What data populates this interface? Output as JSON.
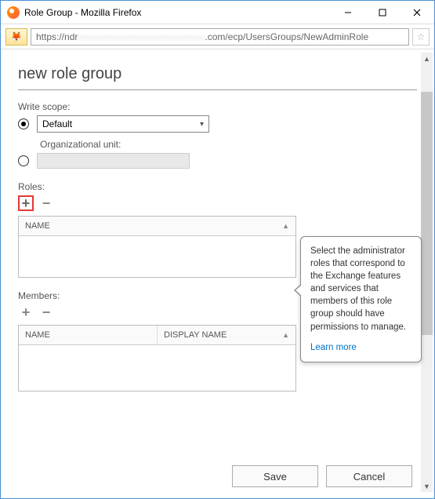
{
  "window": {
    "title": "Role Group - Mozilla Firefox"
  },
  "addressbar": {
    "prefix": "https://ndr",
    "suffix": ".com/ecp/UsersGroups/NewAdminRole"
  },
  "page": {
    "title": "new role group"
  },
  "writeScope": {
    "label": "Write scope:",
    "default_option": "Default",
    "ou_label": "Organizational unit:",
    "ou_value": ""
  },
  "roles": {
    "label": "Roles:",
    "columns": {
      "name": "NAME"
    }
  },
  "members": {
    "label": "Members:",
    "columns": {
      "name": "NAME",
      "display": "DISPLAY NAME"
    }
  },
  "tooltip": {
    "text": "Select the administrator roles that correspond to the Exchange features and services that members of this role group should have permissions to manage.",
    "learn": "Learn more"
  },
  "buttons": {
    "save": "Save",
    "cancel": "Cancel"
  }
}
